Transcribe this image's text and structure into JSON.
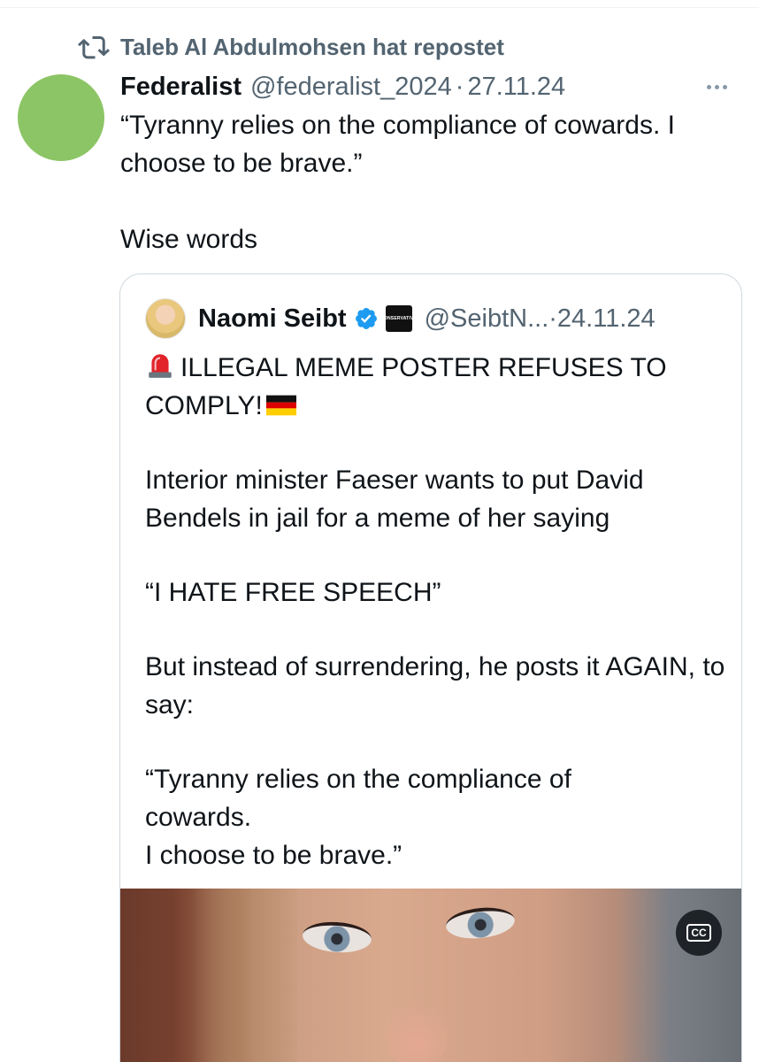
{
  "repost": {
    "icon": "repost-icon",
    "text": "Taleb Al Abdulmohsen hat repostet"
  },
  "post": {
    "avatar_color": "#8cc565",
    "author_name": "Federalist",
    "handle": "@federalist_2024",
    "separator": "·",
    "date": "27.11.24",
    "more_icon": "more-dots-icon",
    "text_line1": "“Tyranny relies on the compliance of cowards. I choose to be brave.”",
    "text_line2": "Wise words"
  },
  "quote": {
    "author_name": "Naomi Seibt",
    "verified_icon": "verified-badge-icon",
    "affiliate_badge": "CONSERVATIVE",
    "handle": "@SeibtN...",
    "separator": "·",
    "date": "24.11.24",
    "headline_a": "ILLEGAL MEME POSTER REFUSES TO",
    "headline_b": "COMPLY!",
    "paragraph1": "Interior minister Faeser wants to put David Bendels in jail for a meme of her saying",
    "paragraph2": "“I HATE FREE SPEECH”",
    "paragraph3": "But instead of surrendering, he posts it AGAIN, to say:",
    "paragraph4_line1": "“Tyranny relies on the compliance of",
    "paragraph4_line2": "cowards.",
    "paragraph4_line3": "I choose to be brave.”",
    "cc_label": "CC"
  },
  "colors": {
    "text": "#0f1419",
    "secondary": "#536471",
    "border": "#cfd9de",
    "verified": "#1d9bf0"
  }
}
